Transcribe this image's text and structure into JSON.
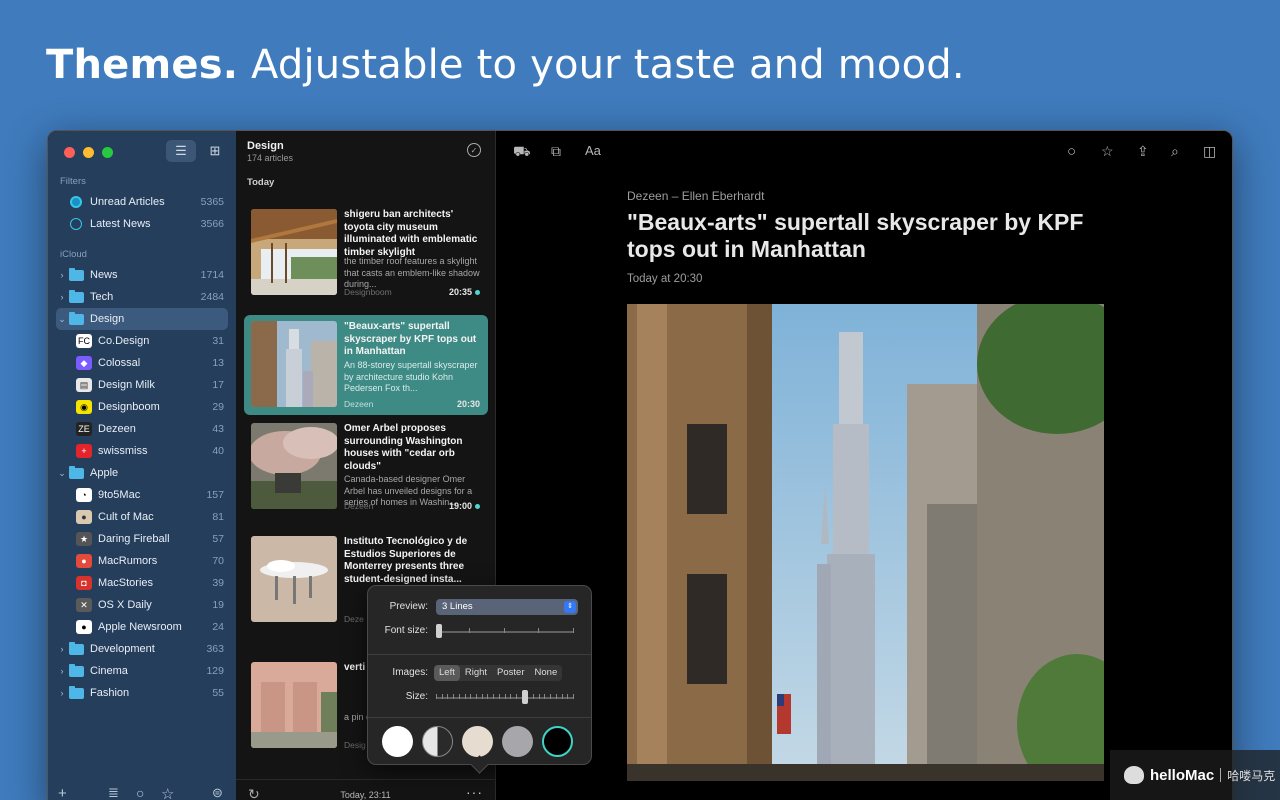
{
  "headline": {
    "bold": "Themes.",
    "rest": "Adjustable to your taste and mood."
  },
  "sidebar": {
    "filters_label": "Filters",
    "filters": [
      {
        "label": "Unread Articles",
        "count": "5365",
        "icon": "unread-ring-icon"
      },
      {
        "label": "Latest News",
        "count": "3566",
        "icon": "clock-icon"
      }
    ],
    "icloud_label": "iCloud",
    "folders": [
      {
        "label": "News",
        "count": "1714"
      },
      {
        "label": "Tech",
        "count": "2484"
      },
      {
        "label": "Design",
        "count": "",
        "selected": true
      }
    ],
    "design_feeds": [
      {
        "label": "Co.Design",
        "count": "31",
        "badge": "FC",
        "color": "#ffffff",
        "fg": "#000"
      },
      {
        "label": "Colossal",
        "count": "13",
        "badge": "◆",
        "color": "#7b5cff",
        "fg": "#fff"
      },
      {
        "label": "Design Milk",
        "count": "17",
        "badge": "▤",
        "color": "#e8e8e8",
        "fg": "#333"
      },
      {
        "label": "Designboom",
        "count": "29",
        "badge": "◉",
        "color": "#f5e400",
        "fg": "#000"
      },
      {
        "label": "Dezeen",
        "count": "43",
        "badge": "ZE",
        "color": "#222",
        "fg": "#fff"
      },
      {
        "label": "swissmiss",
        "count": "40",
        "badge": "+",
        "color": "#e3252b",
        "fg": "#fff"
      }
    ],
    "apple_folder": {
      "label": "Apple"
    },
    "apple_feeds": [
      {
        "label": "9to5Mac",
        "count": "157",
        "badge": "◔",
        "color": "#ffffff",
        "fg": "#000"
      },
      {
        "label": "Cult of Mac",
        "count": "81",
        "badge": "●",
        "color": "#d9c9b0",
        "fg": "#333"
      },
      {
        "label": "Daring Fireball",
        "count": "57",
        "badge": "★",
        "color": "#555",
        "fg": "#fff"
      },
      {
        "label": "MacRumors",
        "count": "70",
        "badge": "●",
        "color": "#e24a3b",
        "fg": "#fff"
      },
      {
        "label": "MacStories",
        "count": "39",
        "badge": "◘",
        "color": "#d8322c",
        "fg": "#fff"
      },
      {
        "label": "OS X Daily",
        "count": "19",
        "badge": "✕",
        "color": "#5a5a5a",
        "fg": "#fff"
      },
      {
        "label": "Apple Newsroom",
        "count": "24",
        "badge": "●",
        "color": "#ffffff",
        "fg": "#000"
      }
    ],
    "more_folders": [
      {
        "label": "Development",
        "count": "363"
      },
      {
        "label": "Cinema",
        "count": "129"
      },
      {
        "label": "Fashion",
        "count": "55"
      }
    ]
  },
  "list": {
    "title": "Design",
    "subtitle": "174 articles",
    "section": "Today",
    "articles": [
      {
        "title": "shigeru ban architects' toyota city museum illuminated with emblematic timber skylight",
        "summary": "the timber roof features a skylight that casts an emblem-like shadow during...",
        "source": "Designboom",
        "time": "20:35",
        "unread": true
      },
      {
        "title": "\"Beaux-arts\" supertall skyscraper by KPF tops out in Manhattan",
        "summary": "An 88-storey supertall skyscraper by architecture studio Kohn Pedersen Fox th...",
        "source": "Dezeen",
        "time": "20:30",
        "unread": false
      },
      {
        "title": "Omer Arbel proposes surrounding Washington houses with \"cedar orb clouds\"",
        "summary": "Canada-based designer Omer Arbel has unveiled designs for a series of homes in Washin...",
        "source": "Dezeen",
        "time": "19:00",
        "unread": true
      },
      {
        "title": "Instituto Tecnológico y de Estudios Superiores de Monterrey presents three student-designed insta...",
        "summary": "",
        "source": "Deze",
        "time": "",
        "unread": false
      },
      {
        "title": "verti brick arch neth",
        "summary": "a pin exter rowh",
        "source": "Desig",
        "time": "",
        "unread": false
      }
    ],
    "footer_time": "Today, 23:11"
  },
  "reader": {
    "byline": "Dezeen – Ellen Eberhardt",
    "title": "\"Beaux-arts\" supertall skyscraper by KPF tops out in Manhattan",
    "date": "Today at 20:30"
  },
  "popover": {
    "preview_label": "Preview:",
    "preview_value": "3 Lines",
    "font_size_label": "Font size:",
    "font_size_level": 0.0,
    "images_label": "Images:",
    "image_options": [
      "Left",
      "Right",
      "Poster",
      "None"
    ],
    "image_selected": "Left",
    "size_label": "Size:",
    "size_level": 0.65,
    "themes": [
      "white",
      "auto",
      "sepia",
      "gray",
      "dark"
    ],
    "theme_selected": "dark"
  },
  "watermark": {
    "brand": "helloMac",
    "cn": "哈喽马克"
  }
}
